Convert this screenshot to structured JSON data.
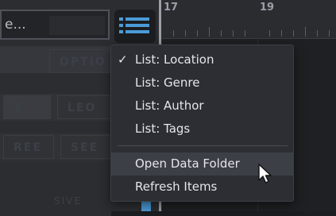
{
  "search": {
    "value": "e..."
  },
  "list_menu": {
    "items": [
      {
        "label": "List: Location",
        "checked": true
      },
      {
        "label": "List: Genre",
        "checked": false
      },
      {
        "label": "List: Author",
        "checked": false
      },
      {
        "label": "List: Tags",
        "checked": false
      }
    ],
    "actions": [
      {
        "label": "Open Data Folder",
        "hovered": true
      },
      {
        "label": "Refresh Items",
        "hovered": false
      }
    ],
    "check_glyph": "✓"
  },
  "left_panel": {
    "options_label": "OPTIO",
    "row_labels": [
      "1",
      "LEO",
      "REE",
      "SEE",
      "SIVE"
    ]
  },
  "ruler": {
    "bar_labels": [
      "17",
      "19"
    ]
  },
  "colors": {
    "accent": "#4b9bd8",
    "menu_background": "#2c2e34",
    "menu_hover": "#3c3f46",
    "menu_text": "#e4e6ea"
  },
  "icons": {
    "list_toggle": "list-icon",
    "cursor": "mouse-pointer-icon"
  }
}
